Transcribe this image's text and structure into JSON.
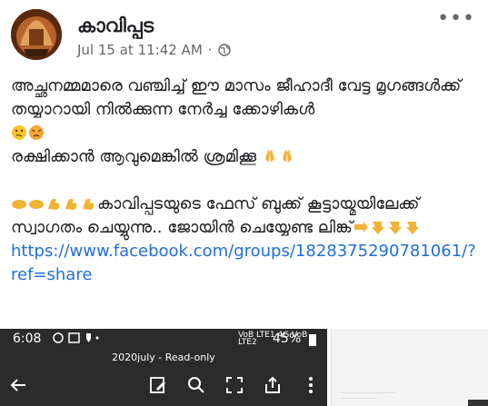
{
  "post": {
    "page_name": "കാവിപ്പട",
    "timestamp": "Jul 15 at 11:42 AM",
    "separator": "·",
    "privacy_icon": "globe-icon",
    "more_icon": "ellipsis-icon",
    "more_label": "•••",
    "text_line_1": "അച്ഛനമ്മമാരെ വഞ്ചിച്ച് ഈ മാസം ജീഹാദീ വേട്ട മൃഗങ്ങൾക്ക് തയ്യാറായി നിൽക്കുന്ന നേർച്ച ക്കോഴികൾ",
    "text_line_2": "രക്ഷിക്കാൻ ആവുമെങ്കിൽ ശ്രമിക്കൂ",
    "text_line_3": "കാവിപ്പടയുടെ ഫേസ് ബുക്ക് കൂട്ടായ്മയിലേക്ക് സ്വാഗതം ചെയ്യുന്നു.. ജോയിൻ ചെയ്യേണ്ട ലിങ്ക്",
    "link": "https://www.facebook.com/groups/1828375290781061/?ref=share"
  },
  "embedded_screenshot": {
    "time": "6:08",
    "network_left": "VoB LTE1 4G",
    "network_right": "VoB LTE2",
    "battery": "45%",
    "doc_title": "2020july - Read-only",
    "toolbar_icons": [
      "back-arrow-icon",
      "edit-icon",
      "search-icon",
      "fullscreen-icon",
      "share-icon",
      "more-vertical-icon"
    ]
  },
  "colors": {
    "link": "#216fdb",
    "text": "#1c1e21",
    "meta": "#65676b",
    "dark_bar": "#2b2b2b"
  }
}
